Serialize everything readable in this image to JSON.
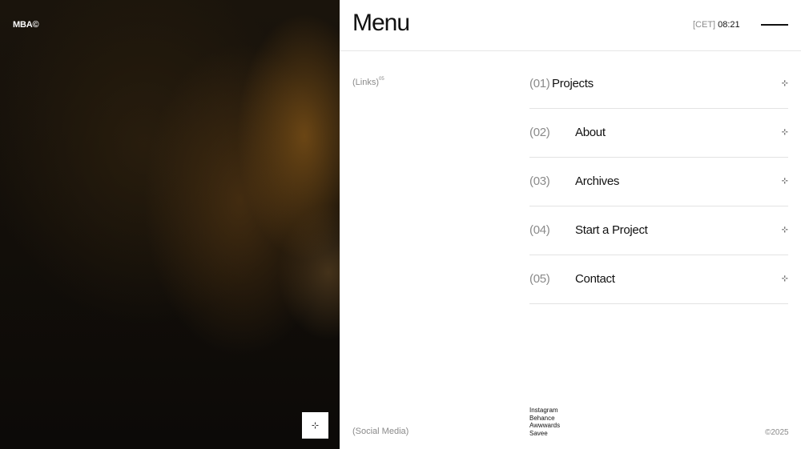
{
  "brand": {
    "name": "MBA©"
  },
  "header": {
    "title": "Menu",
    "timezone": "[CET]",
    "time": "08:21"
  },
  "links_section": {
    "label": "(Links)",
    "count": "05"
  },
  "menu": {
    "items": [
      {
        "num": "(01)",
        "label": "Projects"
      },
      {
        "num": "(02)",
        "label": "About"
      },
      {
        "num": "(03)",
        "label": "Archives"
      },
      {
        "num": "(04)",
        "label": "Start a Project"
      },
      {
        "num": "(05)",
        "label": "Contact"
      }
    ]
  },
  "social": {
    "label": "(Social Media)",
    "links": [
      "Instagram",
      "Behance",
      "Awwwards",
      "Savee"
    ]
  },
  "footer": {
    "copyright": "©2025"
  },
  "icons": {
    "arrow": "⊹",
    "corner_button": "⊹"
  }
}
